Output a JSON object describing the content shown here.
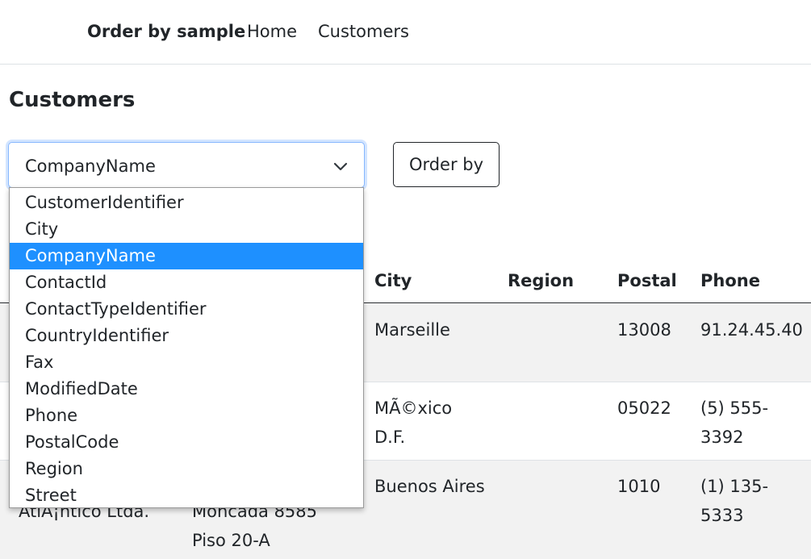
{
  "navbar": {
    "brand": "Order by sample",
    "links": [
      "Home",
      "Customers"
    ]
  },
  "page": {
    "title": "Customers"
  },
  "select": {
    "value": "CompanyName",
    "options": [
      "CustomerIdentifier",
      "City",
      "CompanyName",
      "ContactId",
      "ContactTypeIdentifier",
      "CountryIdentifier",
      "Fax",
      "ModifiedDate",
      "Phone",
      "PostalCode",
      "Region",
      "Street"
    ],
    "selected_index": 2
  },
  "order_button": {
    "label": "Order by"
  },
  "table": {
    "visible_headers": [
      "City",
      "Region",
      "Postal",
      "Phone"
    ],
    "rows": [
      {
        "company": "",
        "street": "",
        "city": "Marseille",
        "region": "",
        "postal": "13008",
        "phone": "91.24.45.40"
      },
      {
        "company": "",
        "street": "",
        "city": "MÃ©xico D.F.",
        "region": "",
        "postal": "05022",
        "phone": "(5) 555-3392"
      },
      {
        "company": "AtlÃ¡ntico Ltda.",
        "street": "Moncada 8585 Piso 20-A",
        "city": "Buenos Aires",
        "region": "",
        "postal": "1010",
        "phone": "(1) 135-5333"
      }
    ]
  },
  "colors": {
    "highlight": "#1e90ff",
    "stripe": "#f2f2f2",
    "focus_border": "#86b7fe"
  }
}
